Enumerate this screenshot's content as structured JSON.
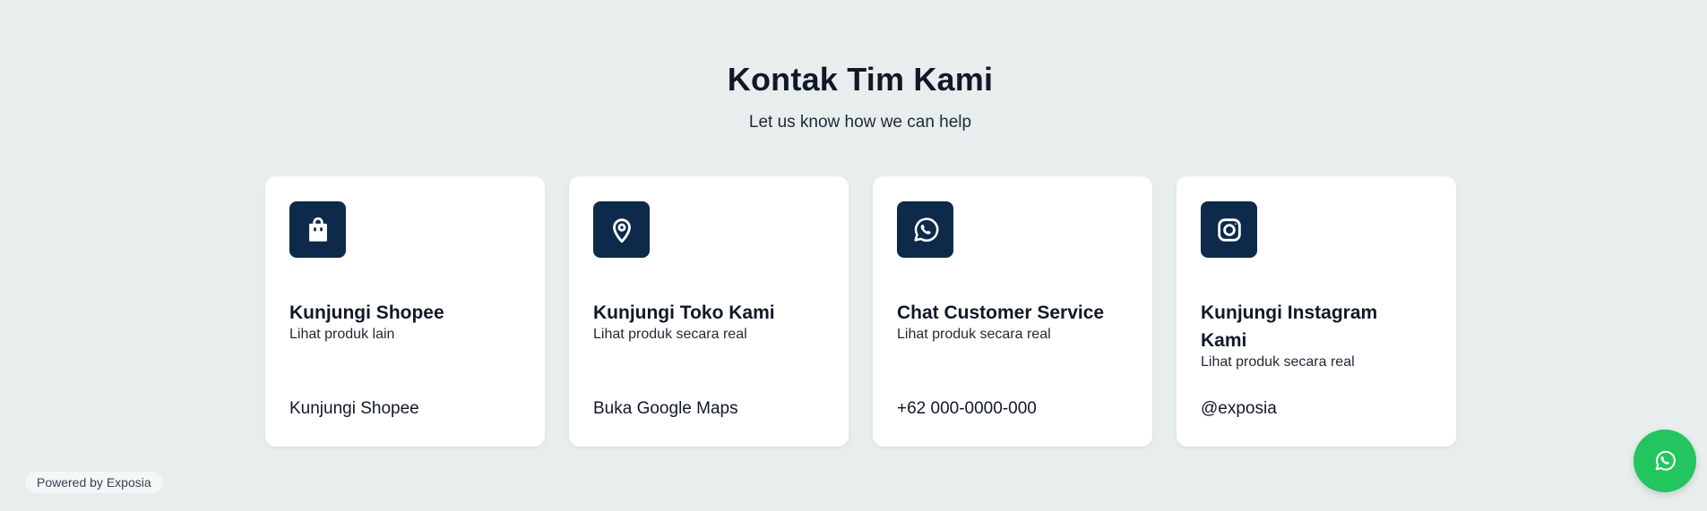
{
  "header": {
    "title": "Kontak Tim Kami",
    "subtitle": "Let us know how we can help"
  },
  "cards": [
    {
      "icon": "shopping-bag-icon",
      "title": "Kunjungi Shopee",
      "description": "Lihat produk lain",
      "link": "Kunjungi Shopee"
    },
    {
      "icon": "map-pin-icon",
      "title": "Kunjungi Toko Kami",
      "description": "Lihat produk secara real",
      "link": "Buka Google Maps"
    },
    {
      "icon": "whatsapp-icon",
      "title": "Chat Customer Service",
      "description": "Lihat produk secara real",
      "link": "+62 000-0000-000"
    },
    {
      "icon": "instagram-icon",
      "title": "Kunjungi Instagram Kami",
      "description": "Lihat produk secara real",
      "link": "@exposia"
    }
  ],
  "footer": {
    "powered_by": "Powered by Exposia"
  },
  "floating_button": {
    "icon": "whatsapp-icon"
  },
  "colors": {
    "background": "#e8eeee",
    "icon_box": "#0d2a4a",
    "whatsapp_green": "#22c55e",
    "card": "#ffffff"
  }
}
